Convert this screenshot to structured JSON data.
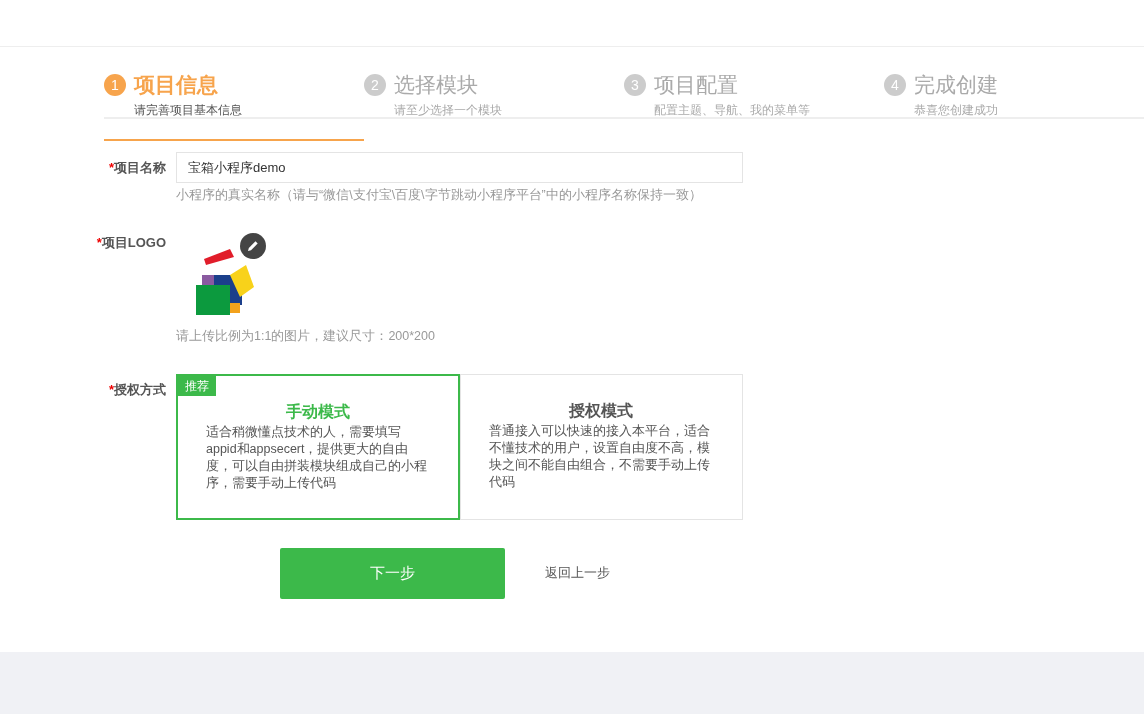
{
  "steps": [
    {
      "number": "1",
      "title": "项目信息",
      "subtitle": "请完善项目基本信息",
      "selected": true
    },
    {
      "number": "2",
      "title": "选择模块",
      "subtitle": "请至少选择一个模块",
      "selected": false
    },
    {
      "number": "3",
      "title": "项目配置",
      "subtitle": "配置主题、导航、我的菜单等",
      "selected": false
    },
    {
      "number": "4",
      "title": "完成创建",
      "subtitle": "恭喜您创建成功",
      "selected": false
    }
  ],
  "form": {
    "name": {
      "required_mark": "*",
      "label": "项目名称",
      "value": "宝箱小程序demo",
      "help": "小程序的真实名称（请与“微信\\支付宝\\百度\\字节跳动小程序平台”中的小程序名称保持一致）"
    },
    "logo": {
      "required_mark": "*",
      "label": "项目LOGO",
      "help": "请上传比例为1:1的图片，建议尺寸：200*200"
    },
    "auth": {
      "required_mark": "*",
      "label": "授权方式",
      "modes": [
        {
          "badge": "推荐",
          "title": "手动模式",
          "description": "适合稍微懂点技术的人，需要填写appid和appsecert，提供更大的自由度，可以自由拼装模块组成自己的小程序，需要手动上传代码",
          "selected": true
        },
        {
          "title": "授权模式",
          "description": "普通接入可以快速的接入本平台，适合不懂技术的用户，设置自由度不高，模块之间不能自由组合，不需要手动上传代码",
          "selected": false
        }
      ]
    }
  },
  "actions": {
    "next": "下一步",
    "back": "返回上一步"
  }
}
